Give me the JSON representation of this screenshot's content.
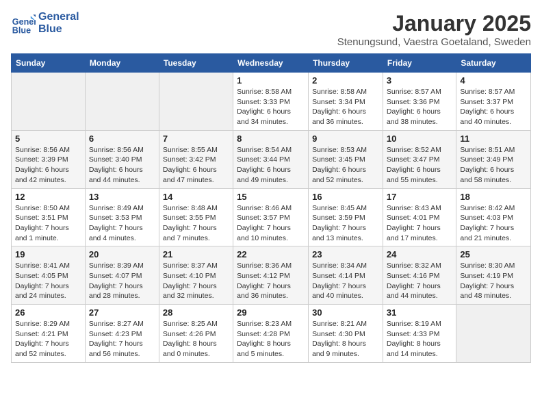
{
  "header": {
    "logo_line1": "General",
    "logo_line2": "Blue",
    "title": "January 2025",
    "subtitle": "Stenungsund, Vaestra Goetaland, Sweden"
  },
  "weekdays": [
    "Sunday",
    "Monday",
    "Tuesday",
    "Wednesday",
    "Thursday",
    "Friday",
    "Saturday"
  ],
  "weeks": [
    [
      {
        "day": "",
        "info": ""
      },
      {
        "day": "",
        "info": ""
      },
      {
        "day": "",
        "info": ""
      },
      {
        "day": "1",
        "info": "Sunrise: 8:58 AM\nSunset: 3:33 PM\nDaylight: 6 hours\nand 34 minutes."
      },
      {
        "day": "2",
        "info": "Sunrise: 8:58 AM\nSunset: 3:34 PM\nDaylight: 6 hours\nand 36 minutes."
      },
      {
        "day": "3",
        "info": "Sunrise: 8:57 AM\nSunset: 3:36 PM\nDaylight: 6 hours\nand 38 minutes."
      },
      {
        "day": "4",
        "info": "Sunrise: 8:57 AM\nSunset: 3:37 PM\nDaylight: 6 hours\nand 40 minutes."
      }
    ],
    [
      {
        "day": "5",
        "info": "Sunrise: 8:56 AM\nSunset: 3:39 PM\nDaylight: 6 hours\nand 42 minutes."
      },
      {
        "day": "6",
        "info": "Sunrise: 8:56 AM\nSunset: 3:40 PM\nDaylight: 6 hours\nand 44 minutes."
      },
      {
        "day": "7",
        "info": "Sunrise: 8:55 AM\nSunset: 3:42 PM\nDaylight: 6 hours\nand 47 minutes."
      },
      {
        "day": "8",
        "info": "Sunrise: 8:54 AM\nSunset: 3:44 PM\nDaylight: 6 hours\nand 49 minutes."
      },
      {
        "day": "9",
        "info": "Sunrise: 8:53 AM\nSunset: 3:45 PM\nDaylight: 6 hours\nand 52 minutes."
      },
      {
        "day": "10",
        "info": "Sunrise: 8:52 AM\nSunset: 3:47 PM\nDaylight: 6 hours\nand 55 minutes."
      },
      {
        "day": "11",
        "info": "Sunrise: 8:51 AM\nSunset: 3:49 PM\nDaylight: 6 hours\nand 58 minutes."
      }
    ],
    [
      {
        "day": "12",
        "info": "Sunrise: 8:50 AM\nSunset: 3:51 PM\nDaylight: 7 hours\nand 1 minute."
      },
      {
        "day": "13",
        "info": "Sunrise: 8:49 AM\nSunset: 3:53 PM\nDaylight: 7 hours\nand 4 minutes."
      },
      {
        "day": "14",
        "info": "Sunrise: 8:48 AM\nSunset: 3:55 PM\nDaylight: 7 hours\nand 7 minutes."
      },
      {
        "day": "15",
        "info": "Sunrise: 8:46 AM\nSunset: 3:57 PM\nDaylight: 7 hours\nand 10 minutes."
      },
      {
        "day": "16",
        "info": "Sunrise: 8:45 AM\nSunset: 3:59 PM\nDaylight: 7 hours\nand 13 minutes."
      },
      {
        "day": "17",
        "info": "Sunrise: 8:43 AM\nSunset: 4:01 PM\nDaylight: 7 hours\nand 17 minutes."
      },
      {
        "day": "18",
        "info": "Sunrise: 8:42 AM\nSunset: 4:03 PM\nDaylight: 7 hours\nand 21 minutes."
      }
    ],
    [
      {
        "day": "19",
        "info": "Sunrise: 8:41 AM\nSunset: 4:05 PM\nDaylight: 7 hours\nand 24 minutes."
      },
      {
        "day": "20",
        "info": "Sunrise: 8:39 AM\nSunset: 4:07 PM\nDaylight: 7 hours\nand 28 minutes."
      },
      {
        "day": "21",
        "info": "Sunrise: 8:37 AM\nSunset: 4:10 PM\nDaylight: 7 hours\nand 32 minutes."
      },
      {
        "day": "22",
        "info": "Sunrise: 8:36 AM\nSunset: 4:12 PM\nDaylight: 7 hours\nand 36 minutes."
      },
      {
        "day": "23",
        "info": "Sunrise: 8:34 AM\nSunset: 4:14 PM\nDaylight: 7 hours\nand 40 minutes."
      },
      {
        "day": "24",
        "info": "Sunrise: 8:32 AM\nSunset: 4:16 PM\nDaylight: 7 hours\nand 44 minutes."
      },
      {
        "day": "25",
        "info": "Sunrise: 8:30 AM\nSunset: 4:19 PM\nDaylight: 7 hours\nand 48 minutes."
      }
    ],
    [
      {
        "day": "26",
        "info": "Sunrise: 8:29 AM\nSunset: 4:21 PM\nDaylight: 7 hours\nand 52 minutes."
      },
      {
        "day": "27",
        "info": "Sunrise: 8:27 AM\nSunset: 4:23 PM\nDaylight: 7 hours\nand 56 minutes."
      },
      {
        "day": "28",
        "info": "Sunrise: 8:25 AM\nSunset: 4:26 PM\nDaylight: 8 hours\nand 0 minutes."
      },
      {
        "day": "29",
        "info": "Sunrise: 8:23 AM\nSunset: 4:28 PM\nDaylight: 8 hours\nand 5 minutes."
      },
      {
        "day": "30",
        "info": "Sunrise: 8:21 AM\nSunset: 4:30 PM\nDaylight: 8 hours\nand 9 minutes."
      },
      {
        "day": "31",
        "info": "Sunrise: 8:19 AM\nSunset: 4:33 PM\nDaylight: 8 hours\nand 14 minutes."
      },
      {
        "day": "",
        "info": ""
      }
    ]
  ]
}
